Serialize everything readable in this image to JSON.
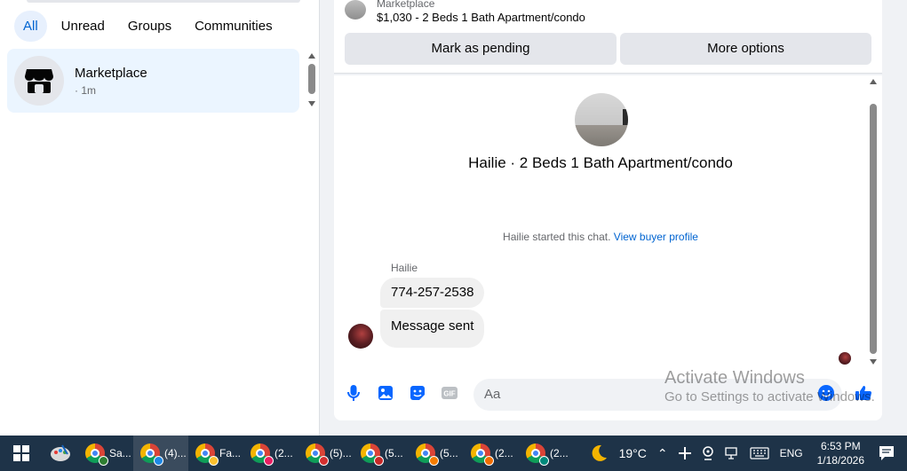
{
  "filters": [
    {
      "label": "All",
      "active": true
    },
    {
      "label": "Unread",
      "active": false
    },
    {
      "label": "Groups",
      "active": false
    },
    {
      "label": "Communities",
      "active": false
    }
  ],
  "conversation": {
    "name": "Marketplace",
    "time": "· 1m"
  },
  "listing": {
    "category": "Marketplace",
    "title": "$1,030 - 2 Beds 1 Bath Apartment/condo"
  },
  "actions": {
    "mark_pending": "Mark as pending",
    "more_options": "More options"
  },
  "chat": {
    "hero_title": "Hailie · 2 Beds 1 Bath Apartment/condo",
    "started_text": "Hailie started this chat.",
    "buyer_profile_link": "View buyer profile",
    "sender_name": "Hailie",
    "messages": [
      "774-257-2538",
      "Message sent"
    ]
  },
  "composer": {
    "placeholder": "Aa"
  },
  "watermark": {
    "line1": "Activate Windows",
    "line2": "Go to Settings to activate Windows."
  },
  "taskbar": {
    "apps": [
      {
        "label": "Sa...",
        "badge": "#2e7d32"
      },
      {
        "label": "(4)...",
        "badge": "#1e88e5",
        "active": true
      },
      {
        "label": "Fa...",
        "badge": "#fbc02d"
      },
      {
        "label": "(2...",
        "badge": "#e91e63"
      },
      {
        "label": "(5)...",
        "badge": "#d32f2f"
      },
      {
        "label": "(5...",
        "badge": "#c62828"
      },
      {
        "label": "(5...",
        "badge": "#f57c00"
      },
      {
        "label": "(2...",
        "badge": "#ef6c00"
      },
      {
        "label": "(2...",
        "badge": "#00897b"
      }
    ],
    "weather": "19°C",
    "language": "ENG",
    "time": "6:53 PM",
    "date": "1/18/2026"
  },
  "colors": {
    "accent": "#0064d1",
    "chip_active_bg": "#e7f0fd",
    "selected_conv_bg": "#ebf5ff",
    "taskbar_bg": "#1e3348"
  }
}
